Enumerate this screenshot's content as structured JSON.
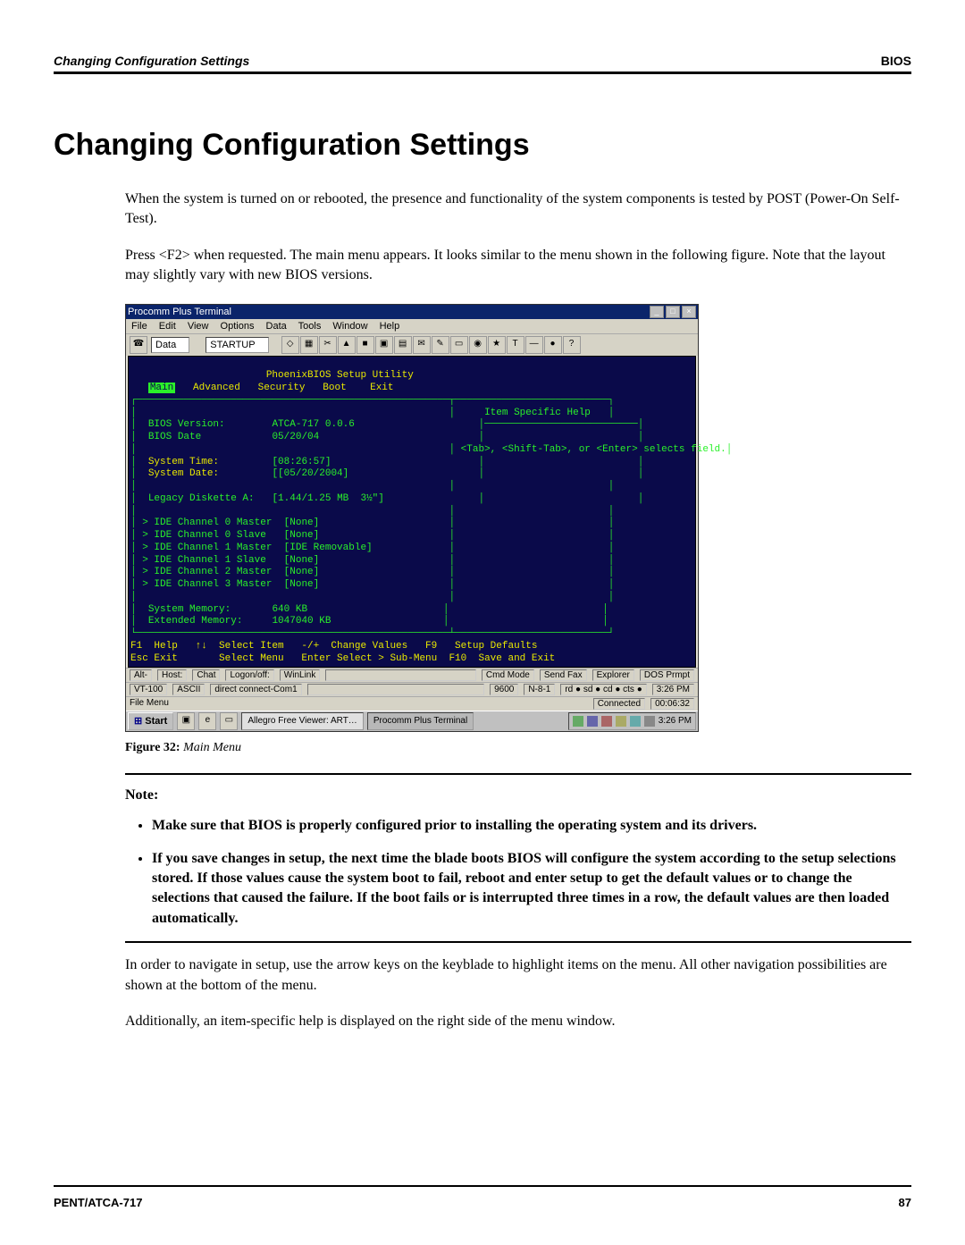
{
  "header": {
    "left": "Changing Configuration Settings",
    "right": "BIOS"
  },
  "title": "Changing Configuration Settings",
  "intro1": "When the system is turned on or rebooted, the presence and functionality of the system components is tested by POST (Power-On Self-Test).",
  "intro2": "Press <F2> when requested. The main menu appears. It looks similar to the menu shown in the following figure. Note that the layout may slightly vary with new BIOS versions.",
  "screenshot": {
    "window_title": "Procomm Plus Terminal",
    "menubar": {
      "items": [
        "File",
        "Edit",
        "View",
        "Options",
        "Data",
        "Tools",
        "Window",
        "Help"
      ]
    },
    "toolbar": {
      "left_label": "Data",
      "script_label": "STARTUP"
    },
    "terminal": {
      "title_line": "PhoenixBIOS Setup Utility",
      "tabs": [
        "Main",
        "Advanced",
        "Security",
        "Boot",
        "Exit"
      ],
      "help_title": "Item Specific Help",
      "help_text": "<Tab>, <Shift-Tab>, or <Enter> selects field.",
      "rows": {
        "bios_version_label": "BIOS Version:",
        "bios_version": "ATCA-717 0.0.6",
        "bios_date_label": "BIOS Date",
        "bios_date": "05/20/04",
        "sys_time_label": "System Time:",
        "sys_time": "[08:26:57]",
        "sys_date_label": "System Date:",
        "sys_date": "[05/20/2004]",
        "legacy_label": "Legacy Diskette A:",
        "legacy_value": "[1.44/1.25 MB  3½\"]",
        "ide0m": "IDE Channel 0 Master",
        "ide0m_v": "[None]",
        "ide0s": "IDE Channel 0 Slave",
        "ide0s_v": "[None]",
        "ide1m": "IDE Channel 1 Master",
        "ide1m_v": "[IDE Removable]",
        "ide1s": "IDE Channel 1 Slave",
        "ide1s_v": "[None]",
        "ide2m": "IDE Channel 2 Master",
        "ide2m_v": "[None]",
        "ide3m": "IDE Channel 3 Master",
        "ide3m_v": "[None]",
        "sysmem_label": "System Memory:",
        "sysmem": "640 KB",
        "extmem_label": "Extended Memory:",
        "extmem": "1047040 KB"
      },
      "footer_keys": "F1  Help   ↑↓  Select Item   -/+  Change Values   F9   Setup Defaults\nEsc Exit       Select Menu   Enter Select > Sub-Menu  F10  Save and Exit"
    },
    "status_row1": {
      "items": [
        "Alt-",
        "Host:",
        "Chat",
        "Logon/off:",
        "WinLink",
        "",
        "Cmd Mode",
        "Send Fax",
        "Explorer",
        "DOS Prmpt"
      ]
    },
    "status_row2": {
      "items": [
        "VT-100",
        "ASCII",
        "direct connect-Com1",
        "",
        "9600",
        "N-8-1",
        "rd ● sd ● cd ● cts ●",
        "3:26 PM"
      ]
    },
    "status_row3": {
      "items": [
        "File Menu",
        "Connected",
        "00:06:32"
      ]
    },
    "taskbar": {
      "start": "Start",
      "items": [
        "Allegro Free Viewer: ART…",
        "Procomm Plus Terminal"
      ],
      "clock": "3:26 PM"
    }
  },
  "figure_caption_label": "Figure 32:",
  "figure_caption_text": "Main Menu",
  "note_heading": "Note:",
  "note_items": [
    "Make sure that BIOS is properly configured prior to installing the operating system and its drivers.",
    "If you save changes in setup, the next time the blade boots BIOS will configure the system according to the setup selections stored. If those values cause the system boot to fail, reboot and enter setup to get the default values or to change the selections that caused the failure. If the boot fails or is interrupted three times in a row, the default values are then loaded automatically."
  ],
  "para_after1": "In order to navigate in setup, use the arrow keys on the keyblade to highlight items on the menu. All other navigation possibilities are shown at the bottom of the menu.",
  "para_after2": "Additionally, an item-specific help is displayed on the right side of the menu window.",
  "footer": {
    "left": "PENT/ATCA-717",
    "right": "87"
  }
}
